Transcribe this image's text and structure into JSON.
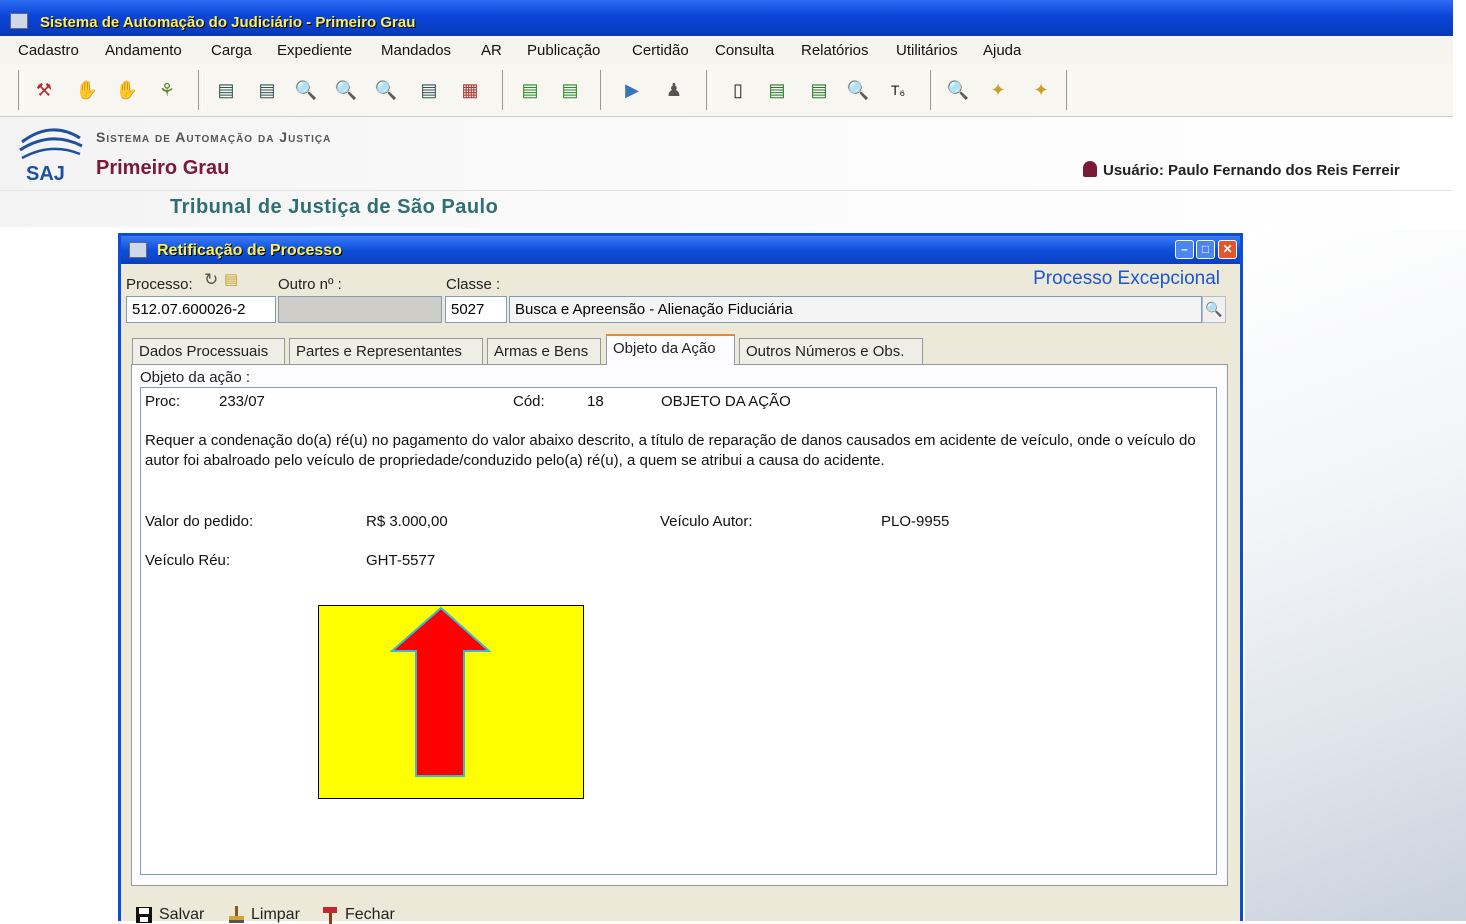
{
  "app": {
    "title": "Sistema de Automação do Judiciário - Primeiro Grau"
  },
  "menu": [
    "Cadastro",
    "Andamento",
    "Carga",
    "Expediente",
    "Mandados",
    "AR",
    "Publicação",
    "Certidão",
    "Consulta",
    "Relatórios",
    "Utilitários",
    "Ajuda"
  ],
  "header": {
    "logo_text": "SAJ",
    "subtitle": "Sistema de Automação da Justiça",
    "grau": "Primeiro Grau",
    "user": "Usuário: Paulo Fernando dos Reis Ferreir",
    "tribunal": "Tribunal de Justiça de São Paulo"
  },
  "dialog": {
    "title": "Retificação de Processo",
    "processo_label": "Processo:",
    "outro_label": "Outro nº :",
    "classe_label": "Classe :",
    "status": "Processo Excepcional",
    "processo_value": "512.07.600026-2",
    "outro_value": "",
    "classe_code": "5027",
    "classe_desc": "Busca e Apreensão - Alienação Fiduciária",
    "tabs": [
      "Dados Processuais",
      "Partes e Representantes",
      "Armas e Bens",
      "Objeto da Ação",
      "Outros Números e Obs."
    ],
    "active_tab": "Objeto da Ação",
    "objeto_label": "Objeto da ação :",
    "objeto": {
      "proc_label": "Proc:",
      "proc_value": "233/07",
      "cod_label": "Cód:",
      "cod_value": "18",
      "heading": "OBJETO DA AÇÃO",
      "paragraph": "Requer a condenação do(a) ré(u) no pagamento do valor abaixo descrito, a título de reparação de danos causados em acidente de veículo, onde o veículo do autor foi abalroado pelo veículo de propriedade/conduzido pelo(a) ré(u), a quem se atribui a causa do acidente.",
      "valor_label": "Valor do pedido:",
      "valor_value": "R$ 3.000,00",
      "veic_autor_label": "Veículo Autor:",
      "veic_autor_value": "PLO-9955",
      "veic_reu_label": "Veículo Réu:",
      "veic_reu_value": "GHT-5577"
    },
    "buttons": {
      "salvar": "Salvar",
      "limpar": "Limpar",
      "fechar": "Fechar"
    }
  },
  "colors": {
    "titlebar": "#0a45d8",
    "title_text": "#ffef5a",
    "overlay_bg": "#ffff00",
    "arrow": "#ff0000",
    "arrow_outline": "#33bbdd",
    "status_blue": "#1c55d6",
    "grau_color": "#7a1a34",
    "tribunal_color": "#2f6e73"
  }
}
